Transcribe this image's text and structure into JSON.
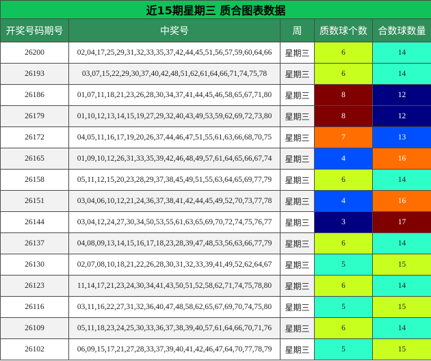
{
  "title": "近15期星期三 质合图表数据",
  "headers": [
    "开奖号码期号",
    "中奖号",
    "周",
    "质数球个数",
    "合数球数量"
  ],
  "palette": {
    "3": {
      "bg": "#000080",
      "fg": "#ffffff"
    },
    "4": {
      "bg": "#0050ff",
      "fg": "#ffffff"
    },
    "5": {
      "bg": "#2effc8",
      "fg": "#222222"
    },
    "6": {
      "bg": "#c8ff1e",
      "fg": "#222222"
    },
    "7": {
      "bg": "#ff6e00",
      "fg": "#ffffff"
    },
    "8": {
      "bg": "#800000",
      "fg": "#ffffff"
    },
    "12": {
      "bg": "#000080",
      "fg": "#ffffff"
    },
    "13": {
      "bg": "#0050ff",
      "fg": "#ffffff"
    },
    "14": {
      "bg": "#2effc8",
      "fg": "#222222"
    },
    "15": {
      "bg": "#c8ff1e",
      "fg": "#222222"
    },
    "16": {
      "bg": "#ff6e00",
      "fg": "#ffffff"
    },
    "17": {
      "bg": "#800000",
      "fg": "#ffffff"
    }
  },
  "rows": [
    {
      "period": "26200",
      "numbers": "02,04,17,25,29,31,32,33,35,37,42,44,45,51,56,57,59,60,64,66",
      "week": "星期三",
      "prime": "6",
      "composite": "14"
    },
    {
      "period": "26193",
      "numbers": "03,07,15,22,29,30,37,40,42,48,51,62,61,64,66,71,74,75,78",
      "week": "星期三",
      "prime": "6",
      "composite": "14"
    },
    {
      "period": "26186",
      "numbers": "01,07,11,18,21,23,26,28,30,34,37,41,44,45,46,58,65,67,71,80",
      "week": "星期三",
      "prime": "8",
      "composite": "12"
    },
    {
      "period": "26179",
      "numbers": "01,10,12,13,14,15,19,27,29,32,40,43,49,53,59,62,69,72,73,80",
      "week": "星期三",
      "prime": "8",
      "composite": "12"
    },
    {
      "period": "26172",
      "numbers": "04,05,11,16,17,19,20,26,37,44,46,47,51,55,61,63,66,68,70,75",
      "week": "星期三",
      "prime": "7",
      "composite": "13"
    },
    {
      "period": "26165",
      "numbers": "01,09,10,12,26,31,33,35,39,42,46,48,49,57,61,64,65,66,67,74",
      "week": "星期三",
      "prime": "4",
      "composite": "16"
    },
    {
      "period": "26158",
      "numbers": "05,11,12,15,20,23,28,29,37,38,45,49,51,55,63,64,65,69,77,79",
      "week": "星期三",
      "prime": "6",
      "composite": "14"
    },
    {
      "period": "26151",
      "numbers": "03,04,06,10,12,21,24,36,37,38,41,42,44,45,49,52,70,73,77,78",
      "week": "星期三",
      "prime": "4",
      "composite": "16"
    },
    {
      "period": "26144",
      "numbers": "03,04,12,24,27,30,34,50,53,55,61,63,65,69,70,72,74,75,76,77",
      "week": "星期三",
      "prime": "3",
      "composite": "17"
    },
    {
      "period": "26137",
      "numbers": "04,08,09,13,14,15,16,17,18,23,28,39,47,48,53,56,63,66,77,79",
      "week": "星期三",
      "prime": "6",
      "composite": "14"
    },
    {
      "period": "26130",
      "numbers": "02,07,08,10,18,21,22,26,28,30,31,32,33,39,41,49,52,62,64,67",
      "week": "星期三",
      "prime": "5",
      "composite": "15"
    },
    {
      "period": "26123",
      "numbers": "11,14,17,21,23,24,30,34,41,43,50,51,52,58,62,71,74,75,78,80",
      "week": "星期三",
      "prime": "6",
      "composite": "14"
    },
    {
      "period": "26116",
      "numbers": "03,11,16,22,27,31,32,36,40,47,48,58,62,65,67,69,70,74,75,80",
      "week": "星期三",
      "prime": "5",
      "composite": "15"
    },
    {
      "period": "26109",
      "numbers": "05,11,18,23,24,25,30,33,36,37,38,39,40,57,61,64,66,70,71,76",
      "week": "星期三",
      "prime": "6",
      "composite": "14"
    },
    {
      "period": "26102",
      "numbers": "06,09,15,17,21,27,28,33,37,39,40,41,42,46,47,64,70,77,78,79",
      "week": "星期三",
      "prime": "5",
      "composite": "15"
    }
  ]
}
